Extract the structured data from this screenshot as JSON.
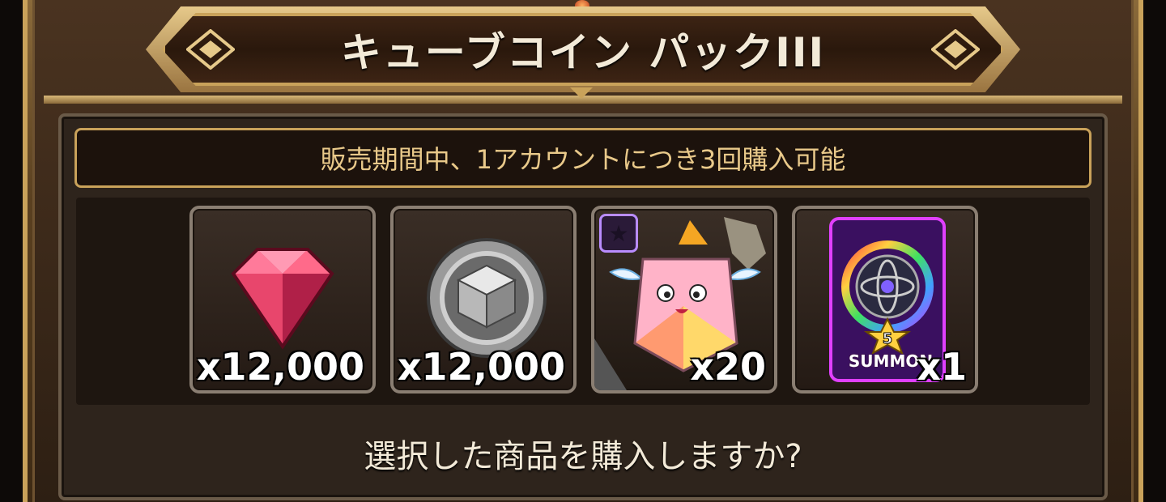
{
  "header": {
    "title": "キューブコイン パックIII"
  },
  "notice": {
    "text": "販売期間中、1アカウントにつき3回購入可能"
  },
  "items": [
    {
      "name": "gem",
      "icon": "red-gem-icon",
      "quantity": "x12,000"
    },
    {
      "name": "cube-coin",
      "icon": "silver-cube-coin-icon",
      "quantity": "x12,000"
    },
    {
      "name": "cube-pet-piece",
      "icon": "winged-cube-character-icon",
      "badge_icon": "purple-star-badge-icon",
      "quantity": "x20"
    },
    {
      "name": "summon-ticket",
      "icon": "summon-ticket-icon",
      "label": "SUMMON",
      "stars": "5",
      "quantity": "x1"
    }
  ],
  "prompt": {
    "text": "選択した商品を購入しますか?"
  },
  "colors": {
    "gold_trim": "#c9a25a",
    "notice_text": "#e9c98a",
    "panel_bg": "#2e241c"
  }
}
